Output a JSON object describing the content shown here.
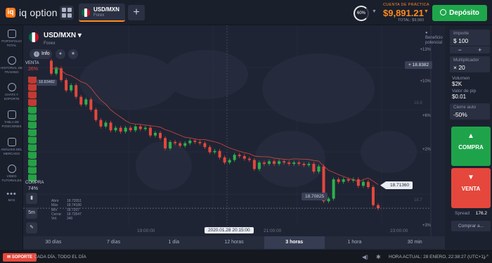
{
  "header": {
    "logo_mark": "iq",
    "logo_text": "iq option",
    "asset_tab": {
      "name": "USD/MXN",
      "type": "Forex"
    },
    "plus": "+",
    "profit_ring": "60%",
    "account_label": "CUENTA DE PRÁCTICA",
    "balance": "$9,891.21",
    "total": "TOTAL: $9,983",
    "deposit_label": "Depósito"
  },
  "sidebar": {
    "items": [
      {
        "icon": "portfolio-icon",
        "label": "PORTAFOLIO TOTAL"
      },
      {
        "icon": "history-icon",
        "label": "HISTORIAL DE TRADING"
      },
      {
        "icon": "chat-icon",
        "label": "CHATS Y SOPORTE"
      },
      {
        "icon": "table-icon",
        "label": "TABLA DE POSICIONES"
      },
      {
        "icon": "analysis-icon",
        "label": "ANÁLISIS DEL MERCADO"
      },
      {
        "icon": "video-icon",
        "label": "VIDEO TUTORIALES"
      },
      {
        "icon": "more-icon",
        "label": "MÁS"
      }
    ]
  },
  "chart": {
    "asset_name": "USD/MXN",
    "asset_type": "Forex",
    "info_label": "Info",
    "beneficio_label": "Beneficio potencial",
    "venta_label": "VENTA",
    "venta_pct": "26%",
    "compra_label": "COMPRA",
    "compra_pct": "74%",
    "timeframe_btn": "5m",
    "price_high": "18.8382",
    "price_current": "18.71360",
    "price_low": "18.70825",
    "price_start": "18.83482",
    "date_tag": "2020.01.28 20:15:00",
    "time_labels": [
      "19:00:00",
      "21:00:00",
      "23:00:00"
    ],
    "right_axis": [
      "+13%",
      "+10%",
      "+6%",
      "+2%",
      "+3%"
    ],
    "grid_prices": [
      "18.8",
      "18.7"
    ],
    "ohlc": [
      {
        "k": "Abrir",
        "v": "18.72051"
      },
      {
        "k": "Máx",
        "v": "18.74186"
      },
      {
        "k": "Mín",
        "v": "18.7207"
      },
      {
        "k": "Cerrar",
        "v": "18.73547"
      },
      {
        "k": "Vol.",
        "v": "340"
      }
    ]
  },
  "timeframes": [
    {
      "label": "30 días",
      "active": false
    },
    {
      "label": "7 días",
      "active": false
    },
    {
      "label": "1 día",
      "active": false
    },
    {
      "label": "12 horas",
      "active": false
    },
    {
      "label": "3 horas",
      "active": true
    },
    {
      "label": "1 hora",
      "active": false
    },
    {
      "label": "30 min",
      "active": false
    }
  ],
  "panel": {
    "amount_label": "Importe",
    "amount_value": "$ 100",
    "minus": "−",
    "plus": "+",
    "multiplier_label": "Multiplicador",
    "multiplier_value": "× 20",
    "volume_label": "Volumen",
    "volume_value": "$2K",
    "pip_label": "Valor de pip",
    "pip_value": "$0.01",
    "auto_close_label": "Cierre auto",
    "auto_close_value": "-50%",
    "compra_btn": "COMPRA",
    "venta_btn": "VENTA",
    "spread_label": "Spread",
    "spread_value": "176.2",
    "comprar_a": "Comprar a..."
  },
  "status": {
    "soporte": "SOPORTE",
    "message": "CADA DÍA, TODO EL DÍA",
    "time": "HORA ACTUAL: 28 ENERO, 22:38:27 (UTC+1)"
  },
  "chart_data": {
    "type": "candlestick",
    "interval": "5m",
    "candles": [
      [
        18.828,
        18.818
      ],
      [
        18.818,
        18.822
      ],
      [
        18.822,
        18.813
      ],
      [
        18.813,
        18.805
      ],
      [
        18.805,
        18.809
      ],
      [
        18.809,
        18.8
      ],
      [
        18.8,
        18.794
      ],
      [
        18.794,
        18.798
      ],
      [
        18.798,
        18.79
      ],
      [
        18.79,
        18.782
      ],
      [
        18.782,
        18.777
      ],
      [
        18.777,
        18.78
      ],
      [
        18.78,
        18.774
      ],
      [
        18.774,
        18.776
      ],
      [
        18.776,
        18.773
      ],
      [
        18.773,
        18.776
      ],
      [
        18.776,
        18.774
      ],
      [
        18.774,
        18.777
      ],
      [
        18.777,
        18.775
      ],
      [
        18.775,
        18.776
      ],
      [
        18.776,
        18.77
      ],
      [
        18.77,
        18.772
      ],
      [
        18.772,
        18.768
      ],
      [
        18.768,
        18.76
      ],
      [
        18.76,
        18.765
      ],
      [
        18.765,
        18.764
      ],
      [
        18.764,
        18.762
      ],
      [
        18.762,
        18.764
      ],
      [
        18.764,
        18.766
      ],
      [
        18.766,
        18.765
      ],
      [
        18.765,
        18.764
      ],
      [
        18.764,
        18.761
      ],
      [
        18.761,
        18.757
      ],
      [
        18.757,
        18.758
      ],
      [
        18.758,
        18.753
      ],
      [
        18.753,
        18.749
      ],
      [
        18.749,
        18.751
      ],
      [
        18.751,
        18.755
      ],
      [
        18.755,
        18.754
      ],
      [
        18.754,
        18.752
      ],
      [
        18.752,
        18.751
      ],
      [
        18.751,
        18.744
      ],
      [
        18.744,
        18.749
      ],
      [
        18.749,
        18.748
      ],
      [
        18.748,
        18.75
      ],
      [
        18.75,
        18.748
      ],
      [
        18.748,
        18.75
      ],
      [
        18.75,
        18.749
      ],
      [
        18.749,
        18.748
      ],
      [
        18.748,
        18.749
      ],
      [
        18.749,
        18.748
      ],
      [
        18.748,
        18.747
      ],
      [
        18.747,
        18.748
      ],
      [
        18.748,
        18.742
      ],
      [
        18.742,
        18.746
      ],
      [
        18.746,
        18.719
      ],
      [
        18.719,
        18.721
      ],
      [
        18.721,
        18.736
      ],
      [
        18.736,
        18.734
      ],
      [
        18.734,
        18.736
      ],
      [
        18.736,
        18.735
      ],
      [
        18.735,
        18.736
      ],
      [
        18.736,
        18.731
      ],
      [
        18.731,
        18.734
      ],
      [
        18.734,
        18.73
      ],
      [
        18.73,
        18.716
      ],
      [
        18.716,
        18.7136
      ]
    ],
    "ylim": [
      18.7,
      18.85
    ],
    "moving_average": true
  }
}
